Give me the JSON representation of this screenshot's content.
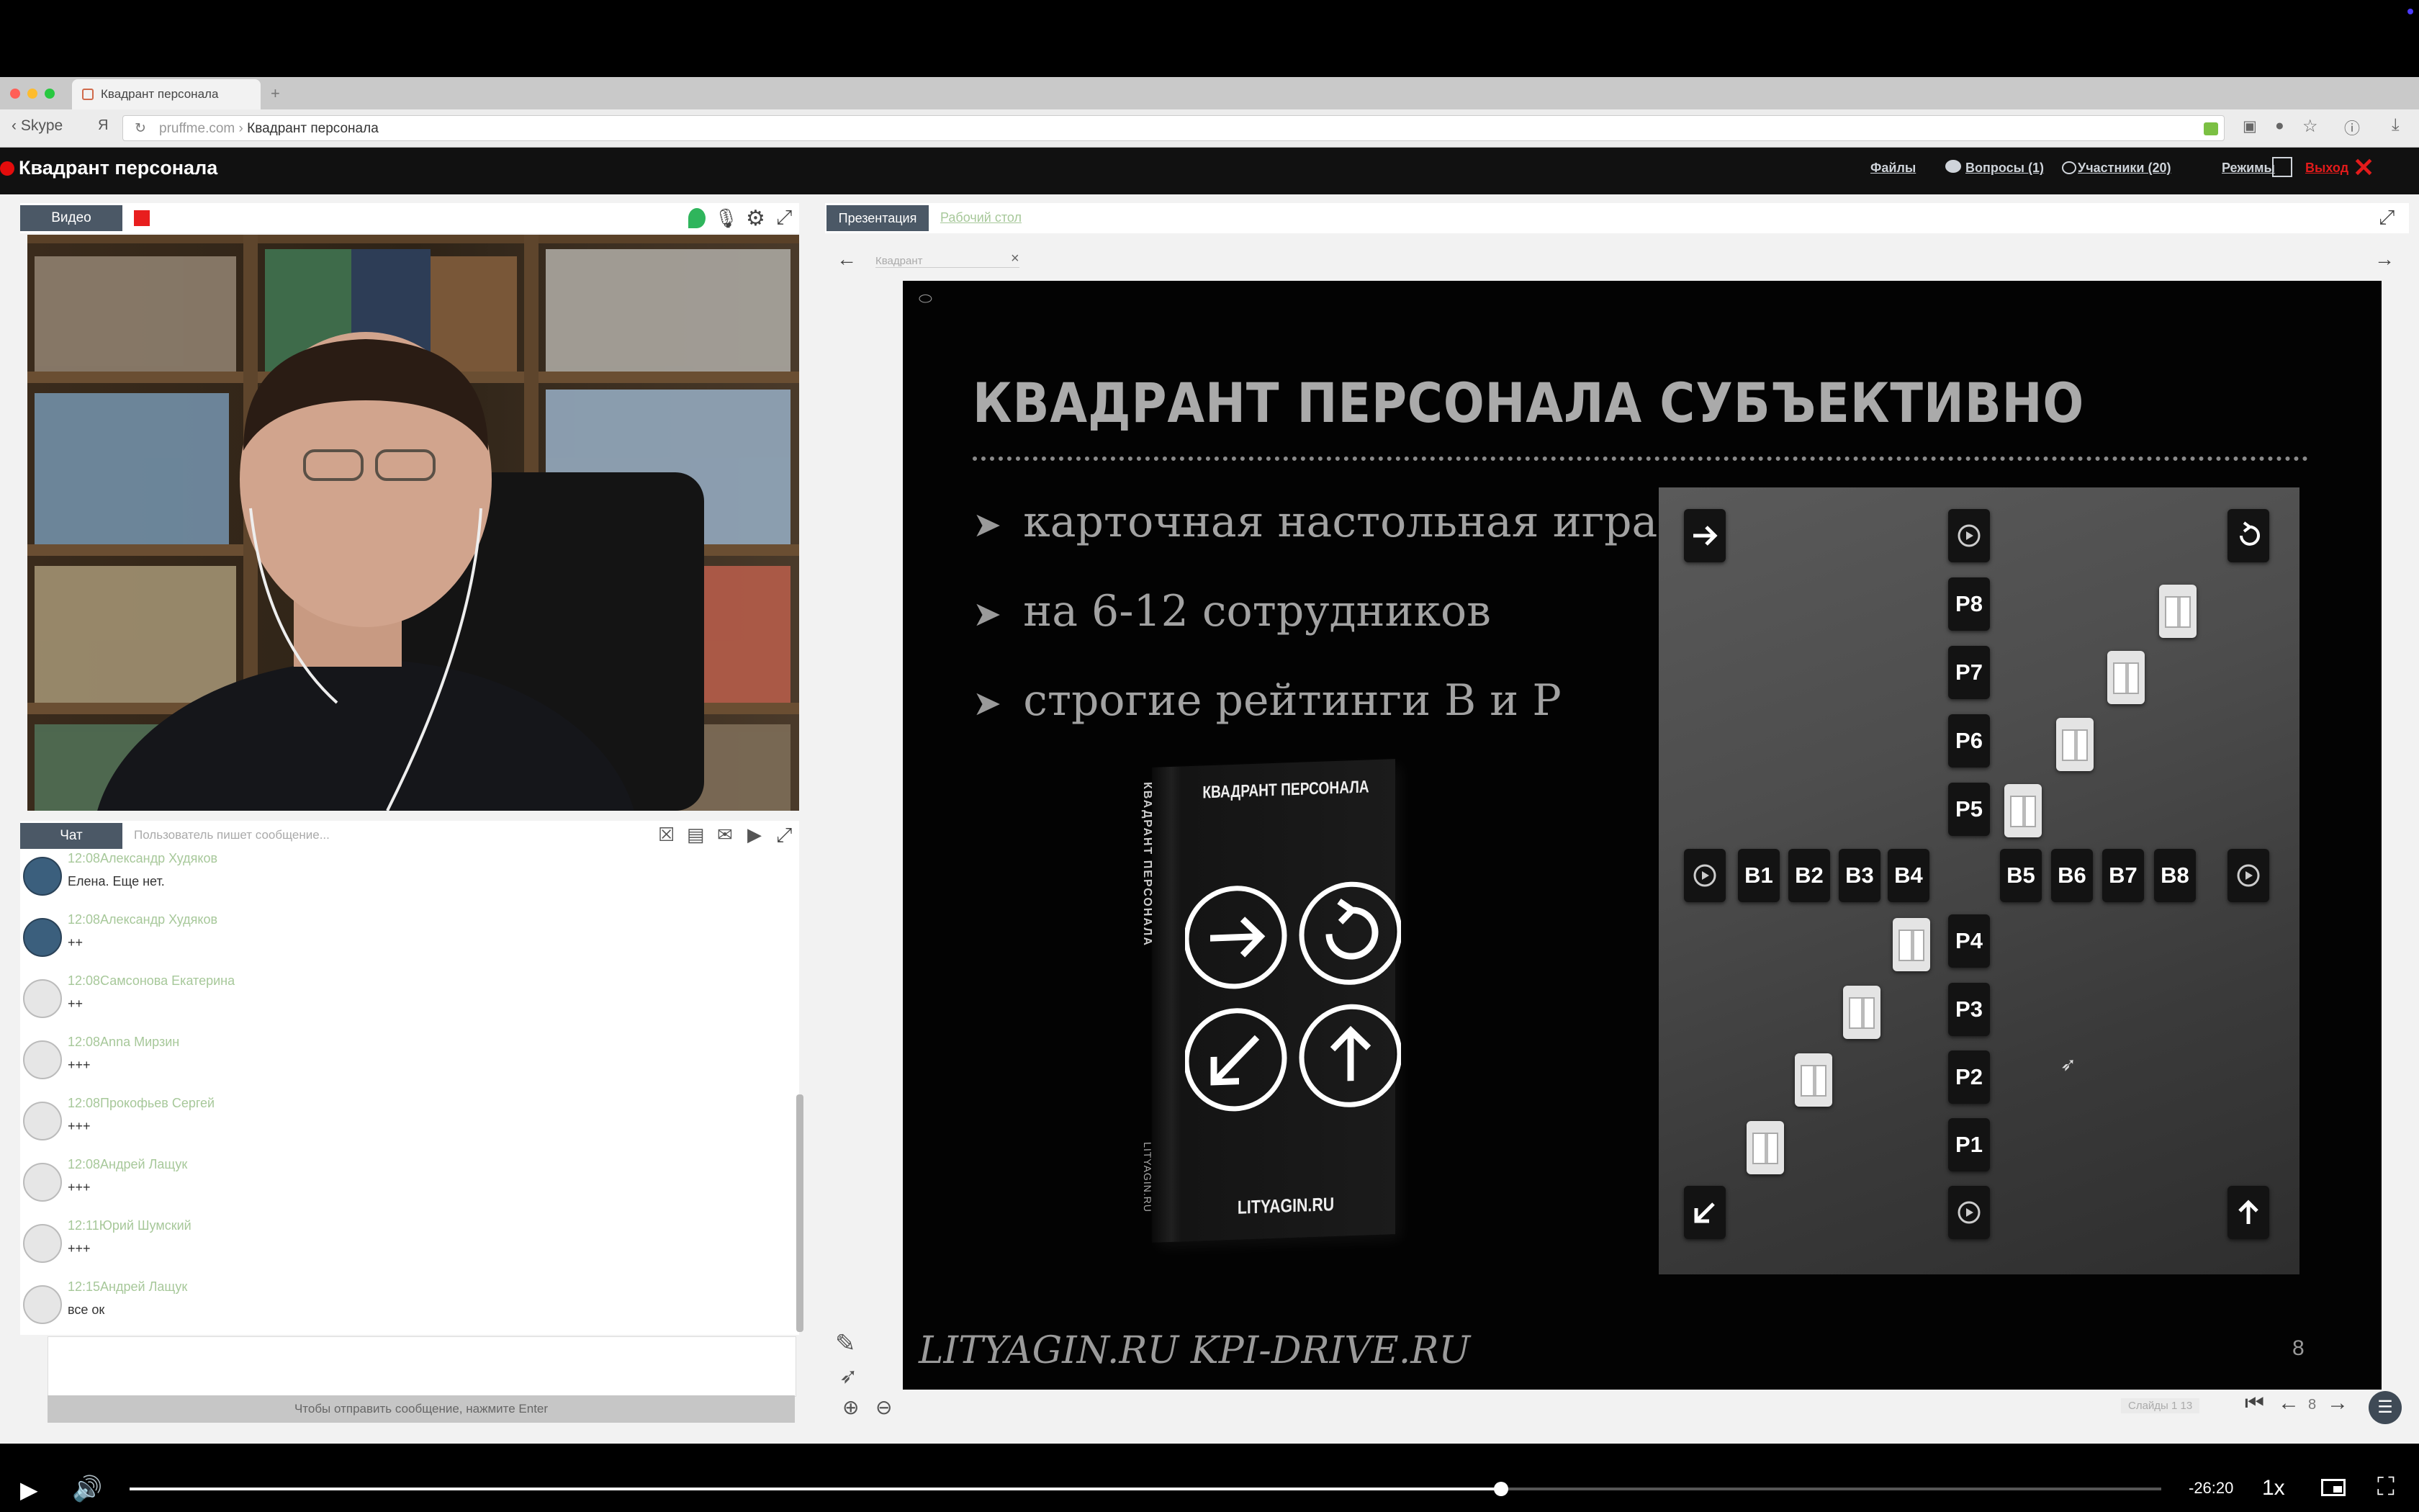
{
  "browser": {
    "tab_title": "Квадрант персонала",
    "back_label": "Skype",
    "url_domain": "pruffme.com",
    "url_title": "Квадрант персонала"
  },
  "app": {
    "title": "Квадрант персонала",
    "nav": {
      "files": "Файлы",
      "questions": "Вопросы (1)",
      "participants": "Участники (20)",
      "modes": "Режимы",
      "exit": "Выход"
    }
  },
  "video_panel": {
    "tab_label": "Видео"
  },
  "chat": {
    "tab_label": "Чат",
    "typing_text": "Пользователь пишет сообщение...",
    "send_hint": "Чтобы отправить сообщение, нажмите Enter",
    "messages": [
      {
        "time": "12:08",
        "author": "Александр Худяков",
        "text": "Елена. Еще нет."
      },
      {
        "time": "12:08",
        "author": "Александр Худяков",
        "text": "++"
      },
      {
        "time": "12:08",
        "author": "Самсонова Екатерина",
        "text": "++"
      },
      {
        "time": "12:08",
        "author": "Anna Мирзин",
        "text": "+++"
      },
      {
        "time": "12:08",
        "author": "Прокофьев Сергей",
        "text": "+++"
      },
      {
        "time": "12:08",
        "author": "Андрей Лащук",
        "text": "+++"
      },
      {
        "time": "12:11",
        "author": "Юрий Шумский",
        "text": "+++"
      },
      {
        "time": "12:15",
        "author": "Андрей Лащук",
        "text": "все ок"
      }
    ]
  },
  "presentation": {
    "tab_presentation": "Презентация",
    "tab_desktop": "Рабочий стол",
    "doc_tab": "Квадрант",
    "slide": {
      "title": "КВАДРАНТ ПЕРСОНАЛА СУБЪЕКТИВНО",
      "bullets": [
        "карточная настольная игра",
        "на 6-12 сотрудников",
        "строгие рейтинги  В и Р"
      ],
      "book_title": "КВАДРАНТ ПЕРСОНАЛА",
      "book_spine": "КВАДРАНТ ПЕРСОНАЛА",
      "book_site": "LITYAGIN.RU",
      "book_spine_site": "LITYAGIN.RU",
      "footer": "LITYAGIN.RU  KPI-DRIVE.RU",
      "slide_number": "8",
      "board": {
        "p_labels": [
          "P8",
          "P7",
          "P6",
          "P5",
          "P4",
          "P3",
          "P2",
          "P1"
        ],
        "b_left": [
          "B1",
          "B2",
          "B3",
          "B4"
        ],
        "b_right": [
          "B5",
          "B6",
          "B7",
          "B8"
        ]
      }
    },
    "pager": {
      "slides_label": "Слайды  1   13",
      "current": "8"
    }
  },
  "player": {
    "time_remaining": "-26:20",
    "speed": "1x",
    "progress": 0.675
  }
}
